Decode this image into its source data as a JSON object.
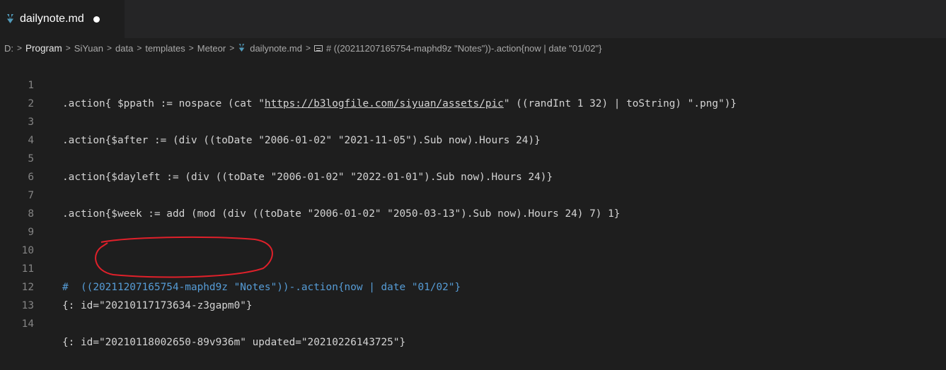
{
  "tab": {
    "title": "dailynote.md",
    "icon": "markdown-file-icon",
    "status": "unsaved-dot"
  },
  "breadcrumb": [
    "D:",
    "Program",
    "SiYuan",
    "data",
    "templates",
    "Meteor",
    "dailynote.md",
    "# ((20211207165754-maphd9z \"Notes\"))-.action{now | date \"01/02\"}"
  ],
  "editor": {
    "lines": [
      {
        "num": "1",
        "text": ".action{ $ppath := nospace (cat \"https://b3logfile.com/siyuan/assets/pic\" ((randInt 1 32) | toString) \".png\")}"
      },
      {
        "num": "2",
        "text": ""
      },
      {
        "num": "3",
        "text": ".action{$after := (div ((toDate \"2006-01-02\" \"2021-11-05\").Sub now).Hours 24)}"
      },
      {
        "num": "4",
        "text": ""
      },
      {
        "num": "5",
        "text": ".action{$dayleft := (div ((toDate \"2006-01-02\" \"2022-01-01\").Sub now).Hours 24)}"
      },
      {
        "num": "6",
        "text": ""
      },
      {
        "num": "7",
        "text": ".action{$week := add (mod (div ((toDate \"2006-01-02\" \"2050-03-13\").Sub now).Hours 24) 7) 1}"
      },
      {
        "num": "8",
        "text": ""
      },
      {
        "num": "9",
        "text": ""
      },
      {
        "num": "10",
        "text": ""
      },
      {
        "num": "11",
        "text": "#  ((20211207165754-maphd9z \"Notes\"))-.action{now | date \"01/02\"}"
      },
      {
        "num": "12",
        "text": "{: id=\"20210117173634-z3gapm0\"}"
      },
      {
        "num": "13",
        "text": ""
      },
      {
        "num": "14",
        "text": "{: id=\"20210118002650-89v936m\" updated=\"20210226143725\"}"
      }
    ]
  },
  "colors": {
    "editor_bg": "#1e1e1e",
    "tabbar_bg": "#252526",
    "text": "#d4d4d4",
    "line_number": "#858585",
    "heading_blue": "#569cd6",
    "markdown_icon": "#519aba",
    "annotation_red": "#e0202a"
  }
}
